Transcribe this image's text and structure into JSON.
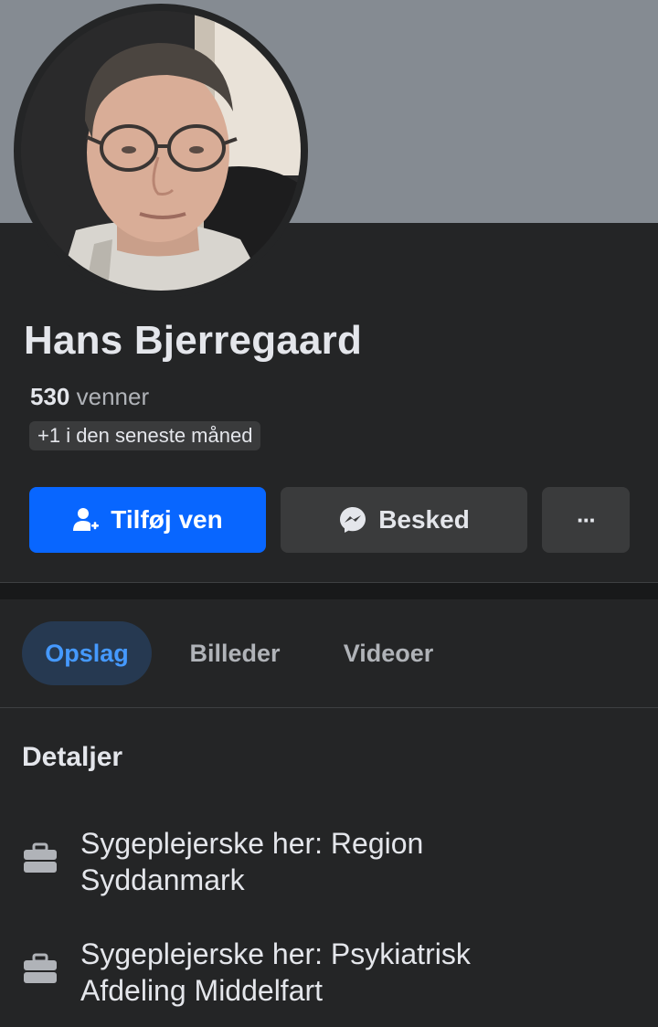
{
  "profile": {
    "name": "Hans Bjerregaard",
    "friends_count": "530",
    "friends_label": "venner",
    "friends_new": "+1 i den seneste måned"
  },
  "actions": {
    "add_friend": "Tilføj ven",
    "message": "Besked",
    "more": "···"
  },
  "tabs": [
    {
      "label": "Opslag",
      "active": true
    },
    {
      "label": "Billeder",
      "active": false
    },
    {
      "label": "Videoer",
      "active": false
    }
  ],
  "details": {
    "title": "Detaljer",
    "items": [
      {
        "icon": "briefcase-icon",
        "line1": "Sygeplejerske her: Region",
        "line2": "Syddanmark"
      },
      {
        "icon": "briefcase-icon",
        "line1": "Sygeplejerske her: Psykiatrisk",
        "line2": "Afdeling Middelfart"
      }
    ]
  },
  "colors": {
    "background": "#242526",
    "cover": "#858b92",
    "primary_button": "#0866ff",
    "secondary_button": "#3a3b3c",
    "active_tab_bg": "#263951",
    "active_tab_text": "#4599ff"
  }
}
